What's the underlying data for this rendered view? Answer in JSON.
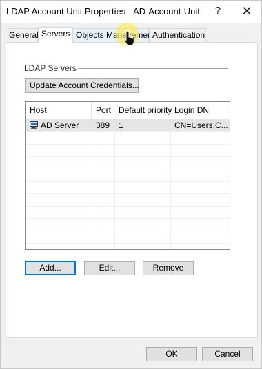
{
  "window": {
    "title": "LDAP Account Unit Properties - AD-Account-Unit",
    "help_label": "?",
    "close_label": "✕"
  },
  "tabs": [
    {
      "label": "General",
      "active": false
    },
    {
      "label": "Servers",
      "active": true
    },
    {
      "label": "Objects Management",
      "active": false
    },
    {
      "label": "Authentication",
      "active": false
    }
  ],
  "ldap_servers": {
    "group_title": "LDAP Servers",
    "update_button": "Update Account Credentials...",
    "columns": [
      "Host",
      "Port",
      "Default priority",
      "Login DN"
    ],
    "rows": [
      {
        "host": "AD Server",
        "port": "389",
        "priority": "1",
        "login_dn": "CN=Users,C...",
        "icon": "server-icon"
      }
    ],
    "add_button": "Add...",
    "edit_button": "Edit...",
    "remove_button": "Remove"
  },
  "footer": {
    "ok_button": "OK",
    "cancel_button": "Cancel"
  },
  "colors": {
    "accent": "#0078d7",
    "highlight": "#ffeb3b"
  },
  "icons": {
    "cursor": "hand-pointer-cursor-icon"
  }
}
